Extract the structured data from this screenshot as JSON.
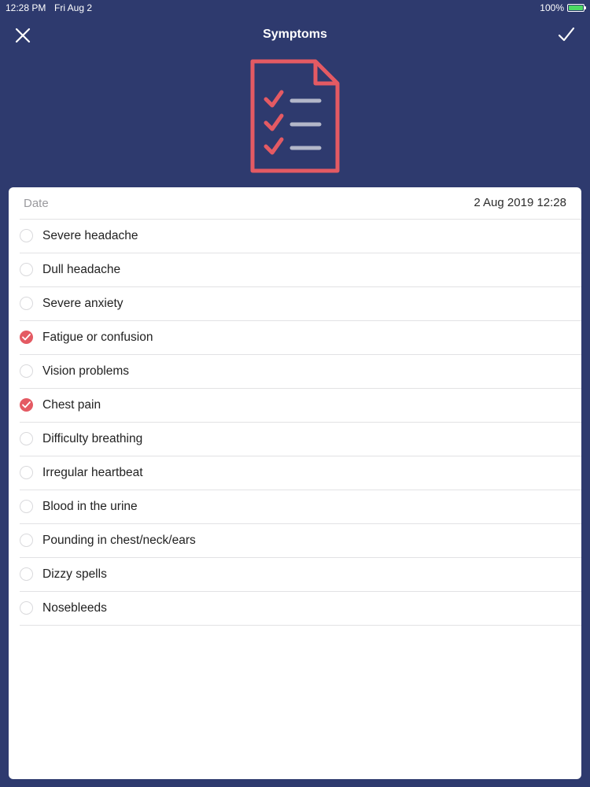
{
  "status": {
    "time": "12:28 PM",
    "date": "Fri Aug 2",
    "battery": "100%",
    "battery_level": 1.0
  },
  "nav": {
    "title": "Symptoms",
    "close_icon": "close-icon",
    "done_icon": "checkmark-icon"
  },
  "hero_icon": "checklist-document-icon",
  "colors": {
    "background": "#2e3a6e",
    "accent": "#e45a63",
    "card": "#ffffff"
  },
  "date": {
    "label": "Date",
    "value": "2 Aug 2019 12:28"
  },
  "symptoms": [
    {
      "label": "Severe headache",
      "checked": false
    },
    {
      "label": "Dull headache",
      "checked": false
    },
    {
      "label": "Severe anxiety",
      "checked": false
    },
    {
      "label": "Fatigue or confusion",
      "checked": true
    },
    {
      "label": "Vision problems",
      "checked": false
    },
    {
      "label": "Chest pain",
      "checked": true
    },
    {
      "label": "Difficulty breathing",
      "checked": false
    },
    {
      "label": "Irregular heartbeat",
      "checked": false
    },
    {
      "label": "Blood in the urine",
      "checked": false
    },
    {
      "label": "Pounding in chest/neck/ears",
      "checked": false
    },
    {
      "label": "Dizzy spells",
      "checked": false
    },
    {
      "label": "Nosebleeds",
      "checked": false
    }
  ]
}
